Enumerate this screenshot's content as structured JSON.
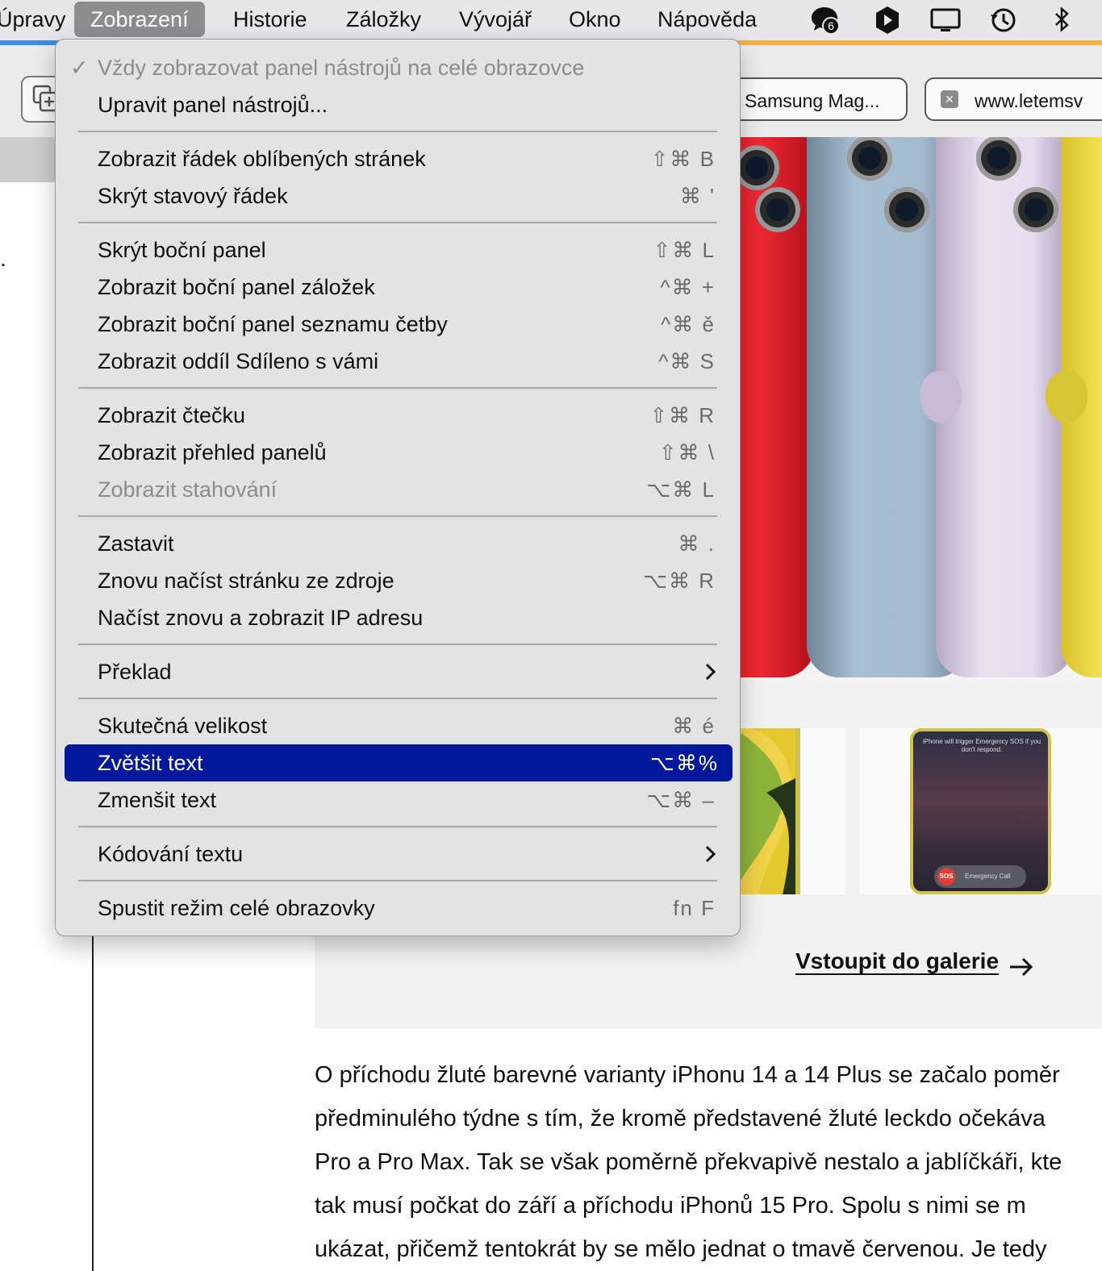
{
  "menubar": {
    "items": [
      "Úpravy",
      "Zobrazení",
      "Historie",
      "Záložky",
      "Vývojář",
      "Okno",
      "Nápověda"
    ],
    "active": "Zobrazení",
    "status_icons": [
      "chat-bubble-icon",
      "shield-play-icon",
      "display-icon",
      "time-machine-icon",
      "bluetooth-icon"
    ],
    "badge_count": "6"
  },
  "tabs": [
    {
      "title": "Samsung Mag..."
    },
    {
      "title": "www.letemsv"
    }
  ],
  "menu": {
    "groups": [
      [
        {
          "label": "Vždy zobrazovat panel nástrojů na celé obrazovce",
          "shortcut": "",
          "checked": true,
          "disabled": true
        },
        {
          "label": "Upravit panel nástrojů...",
          "shortcut": ""
        }
      ],
      [
        {
          "label": "Zobrazit řádek oblíbených stránek",
          "shortcut": "⇧⌘ B"
        },
        {
          "label": "Skrýt stavový řádek",
          "shortcut": "⌘ '"
        }
      ],
      [
        {
          "label": "Skrýt boční panel",
          "shortcut": "⇧⌘ L"
        },
        {
          "label": "Zobrazit boční panel záložek",
          "shortcut": "^⌘ +"
        },
        {
          "label": "Zobrazit boční panel seznamu četby",
          "shortcut": "^⌘ ě"
        },
        {
          "label": "Zobrazit oddíl Sdíleno s vámi",
          "shortcut": "^⌘ S"
        }
      ],
      [
        {
          "label": "Zobrazit čtečku",
          "shortcut": "⇧⌘ R"
        },
        {
          "label": "Zobrazit přehled panelů",
          "shortcut": "⇧⌘ \\"
        },
        {
          "label": "Zobrazit stahování",
          "shortcut": "⌥⌘ L",
          "disabled": true
        }
      ],
      [
        {
          "label": "Zastavit",
          "shortcut": "⌘ ."
        },
        {
          "label": "Znovu načíst stránku ze zdroje",
          "shortcut": "⌥⌘ R"
        },
        {
          "label": "Načíst znovu a zobrazit IP adresu",
          "shortcut": ""
        }
      ],
      [
        {
          "label": "Překlad",
          "shortcut": "",
          "submenu": true
        }
      ],
      [
        {
          "label": "Skutečná velikost",
          "shortcut": "⌘ é"
        },
        {
          "label": "Zvětšit text",
          "shortcut": "⌥⌘%",
          "highlighted": true
        },
        {
          "label": "Zmenšit text",
          "shortcut": "⌥⌘ –"
        }
      ],
      [
        {
          "label": "Kódování textu",
          "shortcut": "",
          "submenu": true
        }
      ],
      [
        {
          "label": "Spustit režim celé obrazovky",
          "shortcut": "fn F"
        }
      ]
    ]
  },
  "gallery": {
    "link_label": "Vstoupit do galerie",
    "sos_text": "iPhone will trigger Emergency SOS if you don't respond.",
    "sos_badge": "SOS",
    "sos_label": "Emergency Call"
  },
  "article": {
    "lines": [
      "O příchodu žluté barevné varianty iPhonu 14 a 14 Plus se začalo poměr",
      "předminulého týdne s tím, že kromě představené žluté leckdo očekáva",
      "Pro a Pro Max. Tak se však poměrně překvapivě nestalo a jablíčkáři, kte",
      "tak musí počkat do září a příchodu iPhonů 15 Pro. Spolu s nimi se m",
      "ukázat, přičemž tentokrát by se mělo jednat o tmavě červenou. Je tedy"
    ]
  },
  "colors": {
    "highlight": "#00199c",
    "menu_bg": "#e4e3e4",
    "menubar_bg": "#e7e6eb"
  }
}
